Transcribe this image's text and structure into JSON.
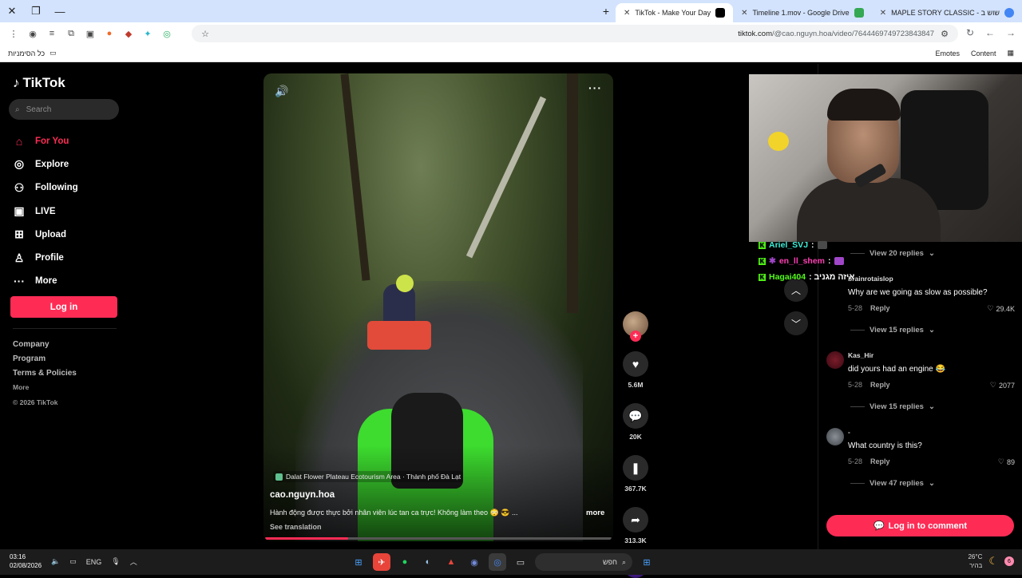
{
  "browser": {
    "tabs": [
      {
        "title": "TikTok - Make Your Day",
        "active": true
      },
      {
        "title": "Timeline 1.mov - Google Drive",
        "active": false
      },
      {
        "title": "MAPLE STORY CLASSIC - שוש ב",
        "active": false
      }
    ],
    "url_host": "tiktok.com",
    "url_path": "/@cao.nguyn.hoa/video/7644469749723843847",
    "bookmarks_left": "כל הסימניות",
    "bookmarks_right": [
      "Emotes",
      "Content"
    ]
  },
  "sidebar": {
    "brand": "TikTok",
    "search_placeholder": "Search",
    "nav": [
      {
        "label": "For You",
        "icon": "home-icon",
        "active": true
      },
      {
        "label": "Explore",
        "icon": "compass-icon",
        "active": false
      },
      {
        "label": "Following",
        "icon": "following-icon",
        "active": false
      },
      {
        "label": "LIVE",
        "icon": "live-icon",
        "active": false
      },
      {
        "label": "Upload",
        "icon": "upload-icon",
        "active": false
      },
      {
        "label": "Profile",
        "icon": "profile-icon",
        "active": false
      },
      {
        "label": "More",
        "icon": "more-icon",
        "active": false
      }
    ],
    "login_label": "Log in",
    "footer": [
      "Company",
      "Program",
      "Terms & Policies",
      "More"
    ],
    "copyright": "© 2026 TikTok"
  },
  "video": {
    "location": "Dalat Flower Plateau Ecotourism Area · Thành phố Đà Lạt",
    "author": "cao.nguyn.hoa",
    "caption": "Hành động được thực bởi nhân viên lúc tan ca trực! Không làm theo 😳 😎 ...",
    "more_label": "more",
    "see_translation": "See translation",
    "progress": 0.24
  },
  "actions": {
    "likes": "5.6M",
    "comments": "20K",
    "saves": "367.7K",
    "shares": "313.3K"
  },
  "chat": [
    {
      "user": "Ariel_SVJ",
      "text": "",
      "color": "#3cf0d8"
    },
    {
      "user": "en_ll_shem",
      "text": "",
      "color": "#ff3fb4"
    },
    {
      "user": "Hagai404",
      "text": ": איזה מגניב",
      "color": "#53fc18"
    }
  ],
  "comments": {
    "items": [
      {
        "view_replies": "View 20 replies"
      },
      {
        "user": "brainrotaislop",
        "text": "Why are we going as slow as possible?",
        "date": "5-28",
        "reply": "Reply",
        "likes": "29.4K",
        "view_replies": "View 15 replies"
      },
      {
        "user": "Kas_Hir",
        "text": "did yours had an engine 😂",
        "date": "5-28",
        "reply": "Reply",
        "likes": "2077",
        "view_replies": "View 15 replies"
      },
      {
        "user": "-",
        "text": "What country is this?",
        "date": "5-28",
        "reply": "Reply",
        "likes": "89",
        "view_replies": "View 47 replies"
      }
    ],
    "login_label": "Log in to comment"
  },
  "taskbar": {
    "time": "03:16",
    "date": "02/08/2026",
    "lang": "ENG",
    "search_text": "חפש",
    "weather": "26°C",
    "weather_sub": "בהיר",
    "notif_count": "6"
  },
  "colors": {
    "accent": "#fe2c55",
    "chrome": "#d3e3fd"
  }
}
